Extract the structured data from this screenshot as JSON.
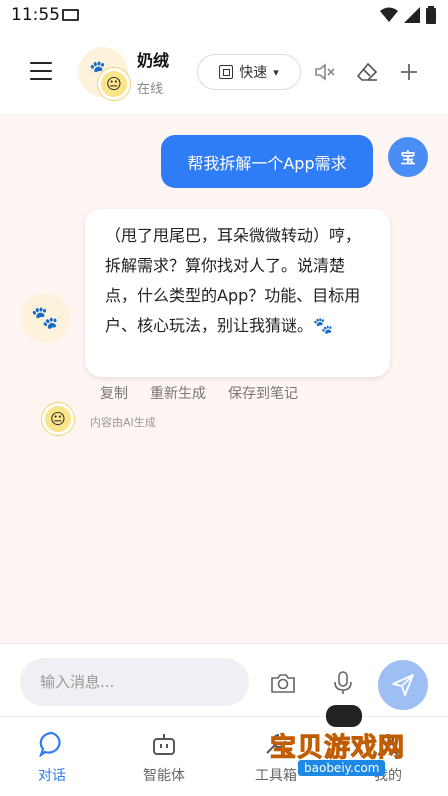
{
  "status_bar": {
    "time": "11:55"
  },
  "header": {
    "agent_name": "奶绒",
    "agent_status": "在线",
    "mode_label": "快速"
  },
  "chat": {
    "user_message": "帮我拆解一个App需求",
    "user_avatar_label": "宝",
    "bot_message": "（甩了甩尾巴，耳朵微微转动）哼，拆解需求？算你找对人了。说清楚点，什么类型的App？功能、目标用户、核心玩法，别让我猜谜。🐾",
    "actions": [
      "复制",
      "重新生成",
      "保存到笔记"
    ],
    "ai_note": "内容由AI生成"
  },
  "input": {
    "placeholder": "输入消息..."
  },
  "tabs": [
    {
      "label": "对话",
      "icon": "chat-bubble-icon",
      "active": true
    },
    {
      "label": "智能体",
      "icon": "robot-icon",
      "active": false
    },
    {
      "label": "工具箱",
      "icon": "toolbox-icon",
      "active": false
    },
    {
      "label": "我的",
      "icon": "profile-icon",
      "active": false
    }
  ],
  "watermark": {
    "text": "宝贝游戏网",
    "url": "baobeiy.com"
  },
  "colors": {
    "accent": "#2e7cf6",
    "chat_bg": "#fff6f4",
    "send_button": "#9dbff3"
  }
}
